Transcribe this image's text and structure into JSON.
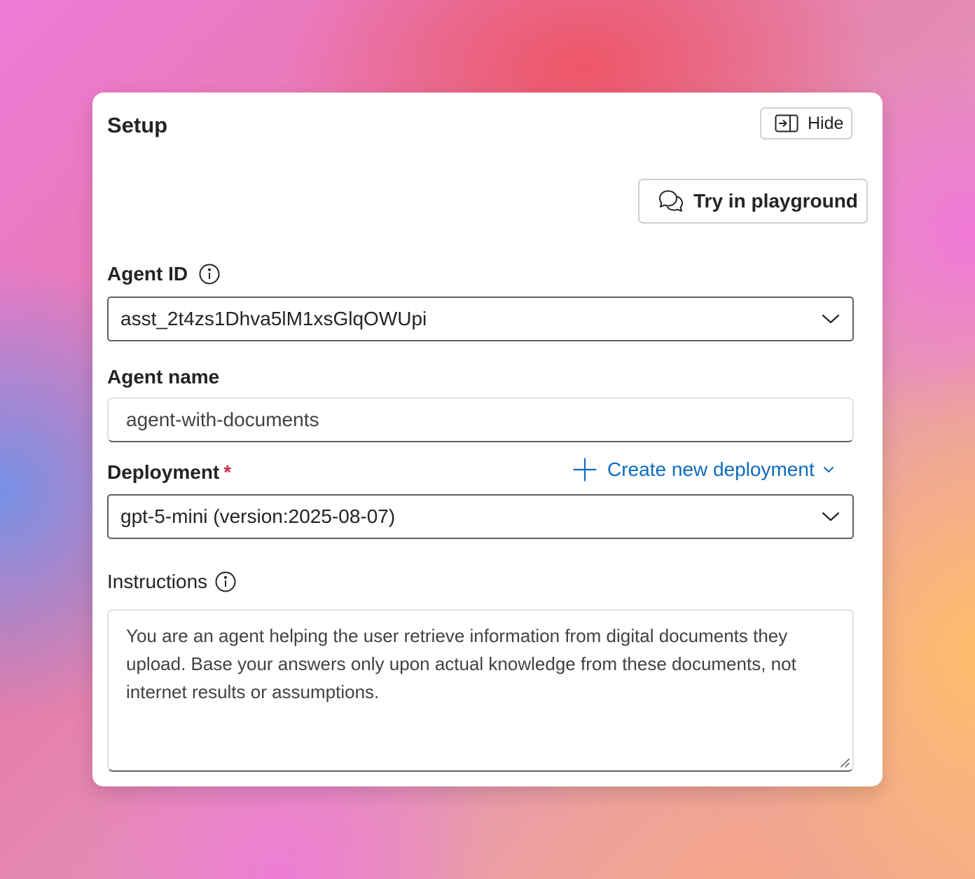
{
  "panel": {
    "title": "Setup",
    "hide_label": "Hide",
    "playground_label": "Try in playground"
  },
  "agent_id": {
    "label": "Agent ID",
    "value": "asst_2t4zs1Dhva5lM1xsGlqOWUpi"
  },
  "agent_name": {
    "label": "Agent name",
    "value": "agent-with-documents"
  },
  "deployment": {
    "label": "Deployment",
    "required_mark": "*",
    "create_label": "Create new deployment",
    "value": "gpt-5-mini (version:2025-08-07)"
  },
  "instructions": {
    "label": "Instructions",
    "value": "You are an agent helping the user retrieve information from digital documents they upload. Base your answers only upon actual knowledge from these documents, not internet results or assumptions."
  },
  "icons": {
    "hide": "panel-collapse-icon",
    "playground": "chat-bubbles-icon",
    "info": "info-icon",
    "chevron": "chevron-down-icon",
    "add": "plus-icon",
    "resize": "resize-handle-icon"
  },
  "colors": {
    "link": "#0f6cbd",
    "required": "#c4314b",
    "text": "#242424"
  }
}
